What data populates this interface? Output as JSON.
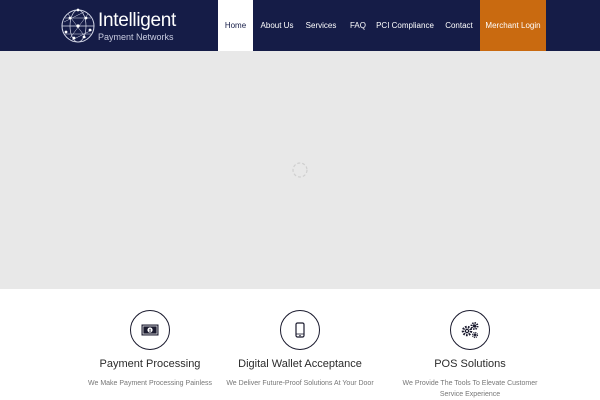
{
  "header": {
    "logo_name": "Intelligent",
    "logo_sub": "Payment Networks",
    "logo_icon": "globe-network-icon",
    "nav": [
      {
        "label": "Home",
        "active": true
      },
      {
        "label": "About Us"
      },
      {
        "label": "Services"
      },
      {
        "label": "FAQ"
      },
      {
        "label": "PCI Compliance"
      },
      {
        "label": "Contact"
      },
      {
        "label": "Merchant Login"
      }
    ]
  },
  "hero": {
    "loading_icon": "spinner-icon"
  },
  "features": [
    {
      "icon": "money-bill-icon",
      "title": "Payment Processing",
      "desc": "We Make Payment Processing Painless"
    },
    {
      "icon": "smartphone-icon",
      "title": "Digital Wallet Acceptance",
      "desc": "We Deliver Future-Proof Solutions At Your Door"
    },
    {
      "icon": "gears-icon",
      "title": "POS Solutions",
      "desc": "We Provide The Tools To Elevate Customer Service Experience"
    }
  ],
  "colors": {
    "header_bg": "#151c47",
    "accent_orange": "#c96a10",
    "hero_bg": "#e8e8e8"
  }
}
